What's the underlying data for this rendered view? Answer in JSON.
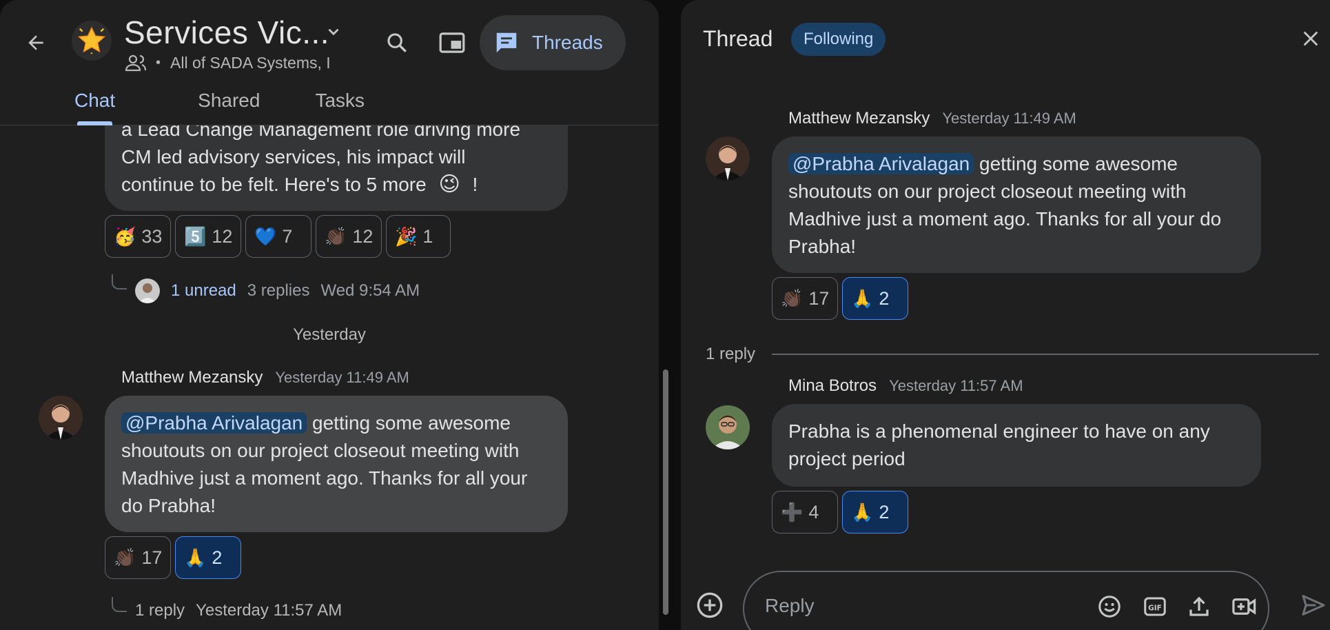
{
  "header": {
    "space_title": "Services Vic...",
    "space_subtitle": "All of SADA Systems, I",
    "threads_label": "Threads",
    "tabs": [
      "Chat",
      "Shared",
      "Tasks"
    ]
  },
  "chat": {
    "prev_message": {
      "lines": [
        "a Lead Change Management role driving more",
        "CM led advisory services, his impact will",
        "continue to be felt. Here's to 5 more"
      ],
      "trailing": "!",
      "wink": "😉"
    },
    "prev_reactions": [
      {
        "emoji": "🥳",
        "count": "33"
      },
      {
        "emoji": "5️⃣",
        "count": "12"
      },
      {
        "emoji": "💙",
        "count": "7"
      },
      {
        "emoji": "👏🏿",
        "count": "12"
      },
      {
        "emoji": "🎉",
        "count": "1"
      }
    ],
    "prev_thread": {
      "unread": "1 unread",
      "replies": "3 replies",
      "time": "Wed 9:54 AM"
    },
    "day_divider": "Yesterday",
    "message": {
      "sender": "Matthew Mezansky",
      "time": "Yesterday 11:49 AM",
      "mention": "@Prabha Arivalagan",
      "text_parts": [
        " getting some awesome",
        "shoutouts on our project closeout meeting with",
        "Madhive just a moment ago. Thanks for all your",
        "do Prabha!"
      ],
      "reactions": [
        {
          "emoji": "👏🏿",
          "count": "17",
          "mine": false
        },
        {
          "emoji": "🙏",
          "count": "2",
          "mine": true
        }
      ],
      "thread": {
        "replies": "1 reply",
        "time": "Yesterday 11:57 AM"
      }
    }
  },
  "thread_panel": {
    "title": "Thread",
    "following_label": "Following",
    "root": {
      "sender": "Matthew Mezansky",
      "time": "Yesterday 11:49 AM",
      "mention": "@Prabha Arivalagan",
      "text_parts": [
        " getting some awesome",
        "shoutouts on our project closeout meeting with",
        "Madhive just a moment ago. Thanks for all your do",
        "Prabha!"
      ],
      "reactions": [
        {
          "emoji": "👏🏿",
          "count": "17",
          "mine": false
        },
        {
          "emoji": "🙏",
          "count": "2",
          "mine": true
        }
      ]
    },
    "reply_count": "1 reply",
    "reply": {
      "sender": "Mina Botros",
      "time": "Yesterday 11:57 AM",
      "lines": [
        "Prabha is a phenomenal engineer to have on any",
        "project period"
      ],
      "reactions": [
        {
          "emoji": "➕",
          "count": "4",
          "mine": false
        },
        {
          "emoji": "🙏",
          "count": "2",
          "mine": true
        }
      ]
    },
    "composer_placeholder": "Reply"
  }
}
